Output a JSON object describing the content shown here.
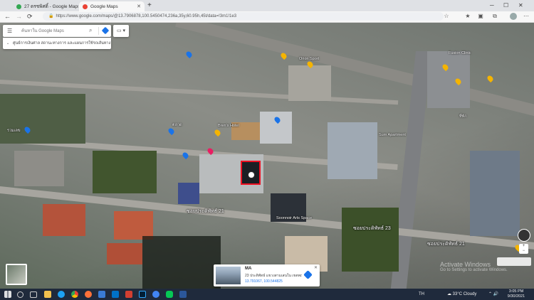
{
  "browser": {
    "tabs": [
      {
        "label": "27 ดรชพิศดิ์ - Google Maps",
        "active": false
      },
      {
        "label": "Google Maps",
        "active": true
      }
    ],
    "url": "https://www.google.com/maps/@13.7906878,100.5450474,236a,35y,60.95h,45t/data=!3m1!1e3"
  },
  "search": {
    "placeholder": "ค้นหาใน Google Maps",
    "suggestion": "ศูนย์การเงินศาล สถานะทางการ และแผนการใช้รถเส้นทาง"
  },
  "map": {
    "labels": [
      "ซอยประดิพัทธ์ 21",
      "ซอยประดิพัทธ์ 23",
      "Soonnoir Arts Space",
      "Bren's Hotel",
      "Orion Sport",
      "ตลาด",
      "Sum Apartment",
      "ที่พัก",
      "Fusion Clinic",
      "รวมเลข"
    ],
    "road_labels": [
      "ซอยประดิพัทธ์ 21",
      "ซอยประดิพัทธ์ 23"
    ]
  },
  "placecard": {
    "title": "MA",
    "address": "23 ประดิพัทธ์ แขวงสามเสนใน เขตพญาไท",
    "coords": "13.791067, 100.544825"
  },
  "watermark": {
    "line1": "Activate Windows",
    "line2": "Go to Settings to activate Windows."
  },
  "taskbar": {
    "lang": "TH",
    "weather": "33°C  Cloudy",
    "time": "3:05 PM",
    "date": "9/30/2021"
  },
  "colors": {
    "accent": "#1a73e8",
    "pin_yellow": "#f5b400",
    "pin_blue": "#1a73e8",
    "select_red": "#e11"
  }
}
